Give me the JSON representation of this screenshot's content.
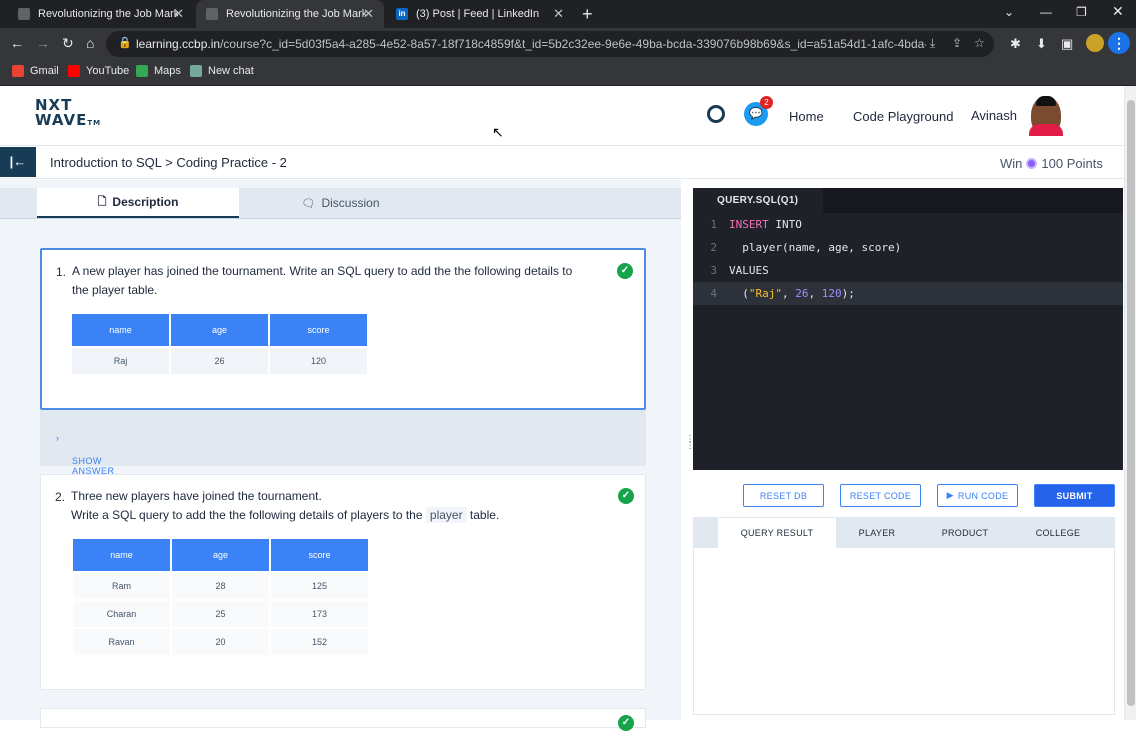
{
  "browser": {
    "tabs": [
      {
        "title": "Revolutionizing the Job Market |",
        "close": "✕"
      },
      {
        "title": "Revolutionizing the Job Market |",
        "close": "✕"
      },
      {
        "title": "(3) Post | Feed | LinkedIn",
        "close": "✕"
      }
    ],
    "linkedin_icon": "in",
    "url_host": "learning.ccbp.in",
    "url_rest": "/course?c_id=5d03f5a4-a285-4e52-8a57-18f718c4859f&t_id=5b2c32ee-9e6e-49ba-bcda-339076b98b69&s_id=a51a54d1-1afc-4bda-a57b-a03...",
    "bookmarks": [
      {
        "label": "Gmail",
        "color": "#ea4335"
      },
      {
        "label": "YouTube",
        "color": "#ff0000"
      },
      {
        "label": "Maps",
        "color": "#34a853"
      },
      {
        "label": "New chat",
        "color": "#74aa9c"
      }
    ]
  },
  "header": {
    "logo_line1": "NXT",
    "logo_line2": "WAVE",
    "logo_tm": "TM",
    "notification_count": "2",
    "links": {
      "home": "Home",
      "playground": "Code Playground"
    },
    "user_name": "Avinash"
  },
  "breadcrumb": {
    "path": "Introduction to SQL > Coding Practice - 2",
    "reward_prefix": "Win",
    "reward_points": "100 Points"
  },
  "left_tabs": {
    "description": "Description",
    "discussion": "Discussion"
  },
  "questions": [
    {
      "number": "1.",
      "text": "A new player has joined the tournament. Write an SQL query to add the the following details to the player table.",
      "table": {
        "headers": [
          "name",
          "age",
          "score"
        ],
        "rows": [
          [
            "Raj",
            "26",
            "120"
          ]
        ]
      }
    },
    {
      "number": "2.",
      "text_line1": "Three new players have joined the tournament.",
      "text_line2_pre": "Write a SQL query to add the the following details of players to the",
      "text_line2_code": "player",
      "text_line2_post": "table.",
      "table": {
        "headers": [
          "name",
          "age",
          "score"
        ],
        "rows": [
          [
            "Ram",
            "28",
            "125"
          ],
          [
            "Charan",
            "25",
            "173"
          ],
          [
            "Ravan",
            "20",
            "152"
          ]
        ]
      }
    }
  ],
  "show_answer": "SHOW ANSWER",
  "editor": {
    "file_tab": "QUERY.SQL(Q1)",
    "lines": [
      {
        "no": "1",
        "kw1": "INSERT",
        "rest": " INTO"
      },
      {
        "no": "2",
        "text": "  player(name, age, score)"
      },
      {
        "no": "3",
        "text": "VALUES"
      },
      {
        "no": "4",
        "p1": "  (",
        "s1": "\"Raj\"",
        "p2": ", ",
        "n1": "26",
        "p3": ", ",
        "n2": "120",
        "p4": ");"
      }
    ]
  },
  "buttons": {
    "reset_db": "RESET DB",
    "reset_code": "RESET CODE",
    "run_code": "RUN CODE",
    "submit": "SUBMIT"
  },
  "result_tabs": [
    "QUERY RESULT",
    "PLAYER",
    "PRODUCT",
    "COLLEGE"
  ],
  "colors": {
    "brand_dark": "#183b56",
    "primary": "#2563eb",
    "success": "#16a34a"
  }
}
